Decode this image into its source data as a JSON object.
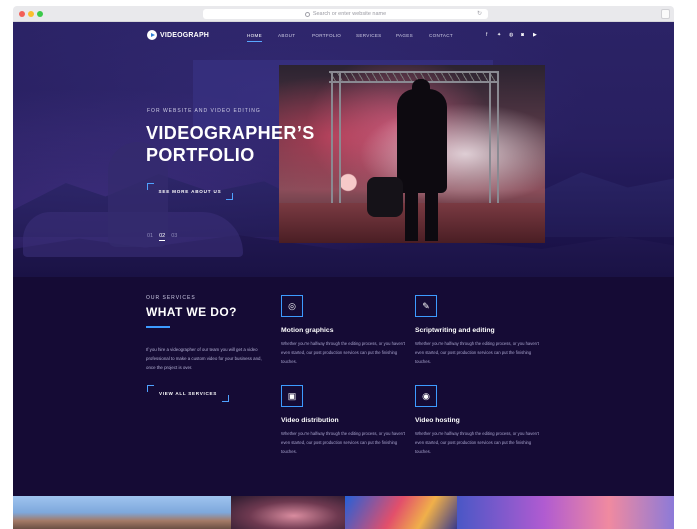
{
  "browser": {
    "url_placeholder": "Search or enter website name"
  },
  "nav": {
    "logo": "VIDEOGRAPH",
    "links": [
      "HOME",
      "ABOUT",
      "PORTFOLIO",
      "SERVICES",
      "PAGES",
      "CONTACT"
    ],
    "active": "HOME",
    "social_icons": [
      "facebook-icon",
      "twitter-icon",
      "dribbble-icon",
      "instagram-icon",
      "youtube-icon"
    ]
  },
  "hero": {
    "kicker": "FOR WEBSITE AND VIDEO EDITING",
    "title_line1": "VIDEOGRAPHER’S",
    "title_line2": "PORTFOLIO",
    "cta": "SEE MORE ABOUT US",
    "slides": [
      "01",
      "02",
      "03"
    ],
    "active_slide": "02"
  },
  "services": {
    "kicker": "OUR SERVICES",
    "heading": "WHAT WE DO?",
    "intro": "If you hire a videographer of our team you will get a video professional to make a custom video for your business and, once the project is over.",
    "cta": "VIEW ALL SERVICES",
    "items": [
      {
        "icon": "target-icon",
        "title": "Motion graphics",
        "desc": "Whether you’re halfway through the editing process, or you haven’t even started, our post production services can put the finishing touches."
      },
      {
        "icon": "script-icon",
        "title": "Scriptwriting and editing",
        "desc": "Whether you’re halfway through the editing process, or you haven’t even started, our post production services can put the finishing touches."
      },
      {
        "icon": "camera-icon",
        "title": "Video distribution",
        "desc": "Whether you’re halfway through the editing process, or you haven’t even started, our post production services can put the finishing touches."
      },
      {
        "icon": "disc-icon",
        "title": "Video hosting",
        "desc": "Whether you’re halfway through the editing process, or you haven’t even started, our post production services can put the finishing touches."
      }
    ]
  },
  "colors": {
    "background": "#150b35",
    "accent": "#3d9bff",
    "text": "#ffffff"
  }
}
